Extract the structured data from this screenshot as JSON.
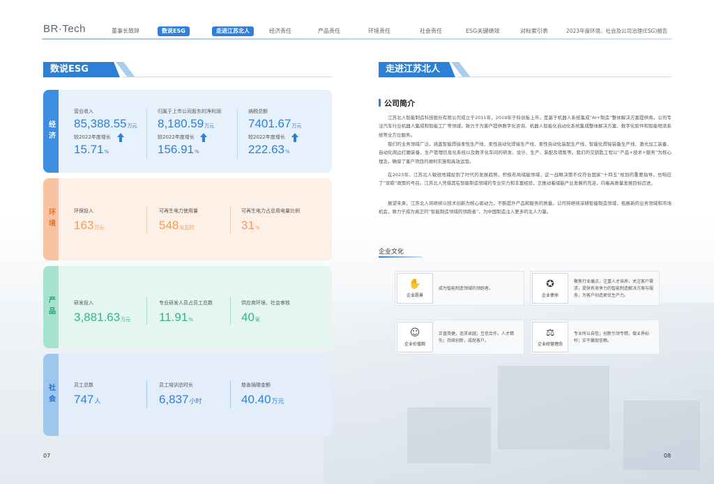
{
  "header": {
    "logo": "BR·Tech",
    "nav": [
      {
        "label": "董事长致辞",
        "active": false
      },
      {
        "label": "数说ESG",
        "active": true
      },
      {
        "label": "走进江苏北人",
        "active": true
      },
      {
        "label": "经济责任",
        "active": false
      },
      {
        "label": "产品责任",
        "active": false
      },
      {
        "label": "环境责任",
        "active": false
      },
      {
        "label": "社会责任",
        "active": false
      },
      {
        "label": "ESG关键绩效",
        "active": false
      },
      {
        "label": "对标索引表",
        "active": false
      },
      {
        "label": "2023年度环境、社会及公司治理(ESG)报告",
        "active": false
      }
    ]
  },
  "left": {
    "title": "数说ESG",
    "sections": [
      {
        "tab": "经济",
        "color": "#2e7fd6",
        "metrics": [
          {
            "label": "营业收入",
            "value": "85,388.55",
            "unit": "万元",
            "sub": "较2022年度增长",
            "pct": "15.71",
            "pct_unit": "%"
          },
          {
            "label": "归属于上市公司股东的净利润",
            "value": "8,180.59",
            "unit": "万元",
            "sub": "较2022年度增长",
            "pct": "156.91",
            "pct_unit": "%"
          },
          {
            "label": "纳税总额",
            "value": "7401.67",
            "unit": "万元",
            "sub": "较2022年度增长",
            "pct": "222.63",
            "pct_unit": "%"
          }
        ]
      },
      {
        "tab": "环境",
        "color": "#f39a5a",
        "metrics": [
          {
            "label": "环保投入",
            "value": "163",
            "unit": "万元"
          },
          {
            "label": "可再生电力使用量",
            "value": "548",
            "unit": "兆瓦时"
          },
          {
            "label": "可再生电力占总用电量比例",
            "value": "31",
            "unit": "%"
          }
        ]
      },
      {
        "tab": "产品",
        "color": "#3dbf95",
        "metrics": [
          {
            "label": "研发投入",
            "value": "3,881.63",
            "unit": "万元"
          },
          {
            "label": "专业研发人员占员工总数",
            "value": "11.91",
            "unit": "%"
          },
          {
            "label": "供应商环境、社会审核",
            "value": "40",
            "unit": "家"
          }
        ]
      },
      {
        "tab": "社会",
        "color": "#2e7fd6",
        "metrics": [
          {
            "label": "员工总数",
            "value": "747",
            "unit": "人"
          },
          {
            "label": "员工培训总时长",
            "value": "6,837",
            "unit": "小时"
          },
          {
            "label": "慈善捐赠金额",
            "value": "40.40",
            "unit": "万元"
          }
        ]
      }
    ],
    "page_number": "07"
  },
  "right": {
    "title": "走进江苏北人",
    "profile_title": "公司简介",
    "paragraphs": [
      "江苏北人智能制造科技股份有限公司成立于2011年，2019年于科创板上市，是基于机器人系统集成“AI+制造”整体解决方案提供商。公司专注汽车行业机器人集成和智能工厂等领域，致力于为客户提供数字化咨询、机器人智能化自动化系统集成整体解决方案、数字化软件和智能物流系统等全方位服务。",
      "我们的业务领域广泛，涵盖智能焊接柔性生产线、柔性自动化焊接生产线、柔性自动化装配生产线、智能化焊接装备生产线、激光加工装备、自动化周边打磨装备、生产管理信息化系统以及数字化车间的研发、设计、生产、装配及销售等。我们的交钥匙工程以“产品+技术+服务”为核心理念，确保了客户项目的顺利实施和高效运营。",
      "在2023年，江苏北人敏锐地捕捉到了时代的发展趋势，积极布局储能领域，这一战略决策不仅符合国家“十四五”规划的重要指导，也响应了“双碳”政策的号召。江苏北人凭借其在智能制造领域的专业实力和丰富经验，正推动着储能产业发展的充足，向着高质量发展目标迈进。",
      "展望未来，江苏北人将继续以技术创新为核心驱动力，不断提升产品和服务的质量。公司将继续深耕智能制造领域，拓展新的业务领域和市场机会，致力于成为真正的“智能制造领域的领跑者”，为中国制造注入更多的北人力量。"
    ],
    "culture_title": "企业文化",
    "culture": [
      {
        "name": "企业愿景",
        "icon": "handshake-icon",
        "glyph": "✋",
        "text": "成为智能制造领域的领跑者。"
      },
      {
        "name": "企业使命",
        "icon": "award-icon",
        "glyph": "✪",
        "text": "聚焦行业痛点，注重人才培养，关注客户需求，提供有竞争力的智能制造解决方案与服务，为客户创造更优生产力。"
      },
      {
        "name": "企业价值观",
        "icon": "team-icon",
        "glyph": "☺",
        "text": "正直简捷，追求卓越；互信合作，人才精先；持续创新，成就客户。"
      },
      {
        "name": "企业经营理念",
        "icon": "balance-icon",
        "glyph": "⚖",
        "text": "专业所以自信；创新引领专精，做业界标杆；实干赢取信赖。"
      }
    ],
    "page_number": "08"
  }
}
